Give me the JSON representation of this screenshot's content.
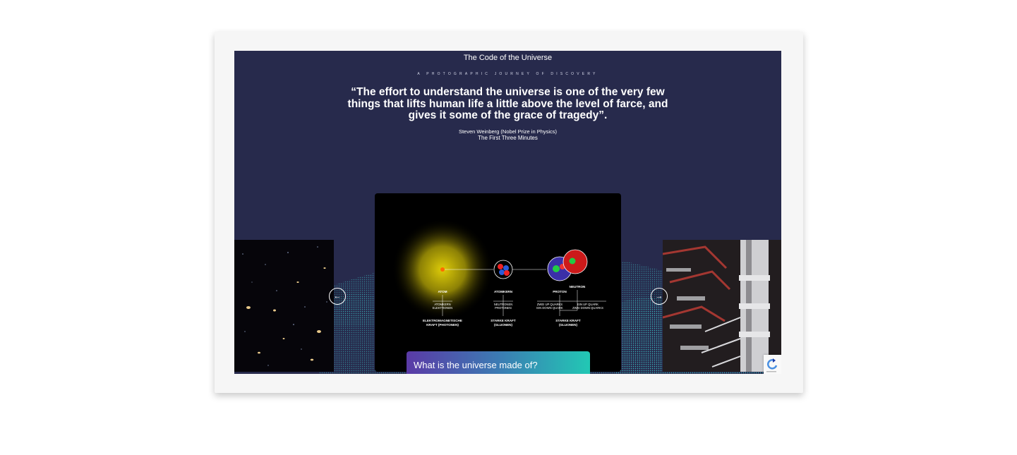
{
  "site": {
    "title": "The Code of the Universe",
    "tagline": "A PHOTOGRAPHIC JOURNEY OF DISCOVERY"
  },
  "quote": {
    "text": "“The effort to understand the universe is one of the very few things that lifts human life a little above the level of farce, and gives it some of the grace of tragedy”.",
    "author": "Steven Weinberg (Nobel Prize in Physics)",
    "source": "The First Three Minutes"
  },
  "slider": {
    "prev_icon": "arrow-left-icon",
    "next_icon": "arrow-right-icon",
    "prev_glyph": "←",
    "next_glyph": "→",
    "caption": "What is the universe made of?",
    "diagram": {
      "atom": "ATOM",
      "atomkern": "ATOMKERN",
      "neutron": "NEUTRON",
      "proton": "PROTON",
      "atomkern_elektronen_1": "ATOMKERN",
      "atomkern_elektronen_2": "ELEKTRONEN",
      "neutronen_protonen_1": "NEUTRONEN",
      "neutronen_protonen_2": "PROTONEN",
      "zwei_up_1": "ZWEI UP QUARKS",
      "zwei_up_2": "EIN DOWN QUARK",
      "ein_up_1": "EIN UP QUARK",
      "ein_up_2": "ZWEI DOWN QUARKS",
      "em_force_1": "ELEKTROMAGNETISCHE",
      "em_force_2": "KRAFT (PHOTONEN)",
      "strong_force_a_1": "STARKE KRAFT",
      "strong_force_a_2": "(GLUONEN)",
      "strong_force_b_1": "STARKE KRAFT",
      "strong_force_b_2": "(GLUONEN)"
    }
  },
  "colors": {
    "background": "#272a4c",
    "caption_gradient": [
      "#5a3aa6",
      "#22c8b4"
    ]
  }
}
